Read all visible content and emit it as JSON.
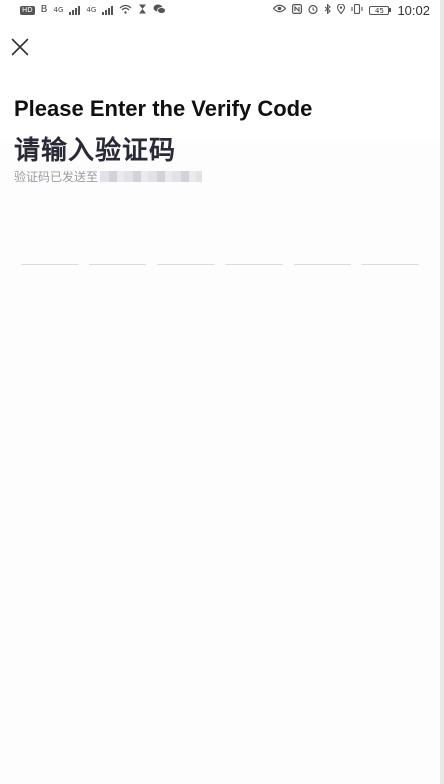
{
  "status_bar": {
    "hd_label": "HD",
    "sim_label": "B",
    "net1": "4G",
    "net2": "4G",
    "battery_level": "45",
    "time": "10:02",
    "icons_left": [
      "hd-icon",
      "signal-icon",
      "signal-icon",
      "wifi-icon",
      "hourglass-icon",
      "wechat-icon"
    ],
    "icons_right": [
      "eye-icon",
      "nfc-icon",
      "alarm-icon",
      "bluetooth-icon",
      "location-icon",
      "vibrate-icon",
      "battery-icon"
    ]
  },
  "header": {
    "close_icon": "close-icon"
  },
  "main": {
    "title_en": "Please Enter the Verify Code",
    "title_cn": "请输入验证码",
    "sent_label": "验证码已发送至",
    "otp_cells": 6
  },
  "colors": {
    "title": "#111111",
    "title_cn": "#2a2a36",
    "hint": "#9a9aa2",
    "underline": "#dcdce0"
  }
}
